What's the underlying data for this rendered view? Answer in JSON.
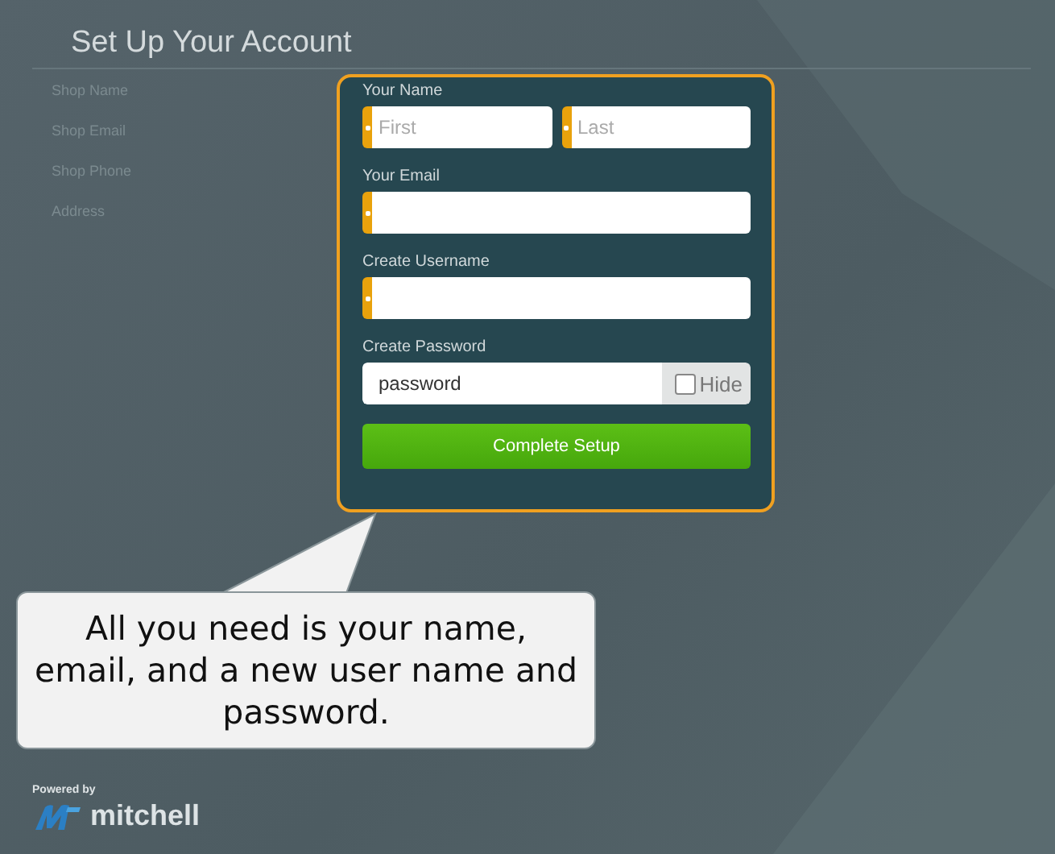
{
  "page": {
    "title": "Set Up Your Account"
  },
  "shop_fields": [
    {
      "label": "Shop Name"
    },
    {
      "label": "Shop Email"
    },
    {
      "label": "Shop Phone"
    },
    {
      "label": "Address"
    }
  ],
  "form": {
    "fields": [
      {
        "kind": "name-pair",
        "label": "Your Name",
        "inputs": [
          {
            "placeholder": "First",
            "required": true
          },
          {
            "placeholder": "Last",
            "required": true
          }
        ]
      },
      {
        "kind": "text",
        "label": "Your Email",
        "required": true
      },
      {
        "kind": "text",
        "label": "Create Username",
        "required": true
      },
      {
        "kind": "password",
        "label": "Create Password",
        "value": "password",
        "toggle": {
          "label": "Hide",
          "checked": false
        }
      }
    ],
    "submit": "Complete Setup"
  },
  "callout": {
    "text": "All you need is your name, email, and a new user name and password."
  },
  "footer": {
    "powered_by": "Powered by",
    "brand": "mitchell"
  }
}
